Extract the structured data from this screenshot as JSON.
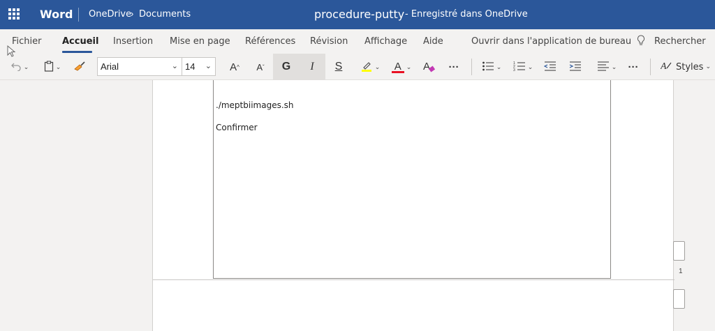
{
  "titlebar": {
    "app_name": "Word",
    "breadcrumb_root": "OneDrive",
    "breadcrumb_sep": "›",
    "breadcrumb_folder": "Documents",
    "doc_title": "procedure-putty",
    "save_status": "-   Enregistré dans OneDrive"
  },
  "tabs": [
    {
      "label": "Fichier"
    },
    {
      "label": "Accueil",
      "active": true
    },
    {
      "label": "Insertion"
    },
    {
      "label": "Mise en page"
    },
    {
      "label": "Références"
    },
    {
      "label": "Révision"
    },
    {
      "label": "Affichage"
    },
    {
      "label": "Aide"
    },
    {
      "label": "Ouvrir dans l'application de bureau"
    },
    {
      "label": "Rechercher"
    }
  ],
  "toolbar": {
    "font_name": "Arial",
    "font_size": "14",
    "grow_font": "A",
    "shrink_font": "A",
    "bold": "G",
    "italic": "I",
    "strike": "S",
    "font_color_letter": "A",
    "clear_format_letter": "A",
    "more": "···",
    "styles_label": "Styles"
  },
  "colors": {
    "brand": "#2b579a",
    "highlight": "#ffff00",
    "font_color": "#e81123"
  },
  "document": {
    "lines": [
      "./meptbiimages.sh",
      "Confirmer"
    ],
    "page_number": "1"
  }
}
